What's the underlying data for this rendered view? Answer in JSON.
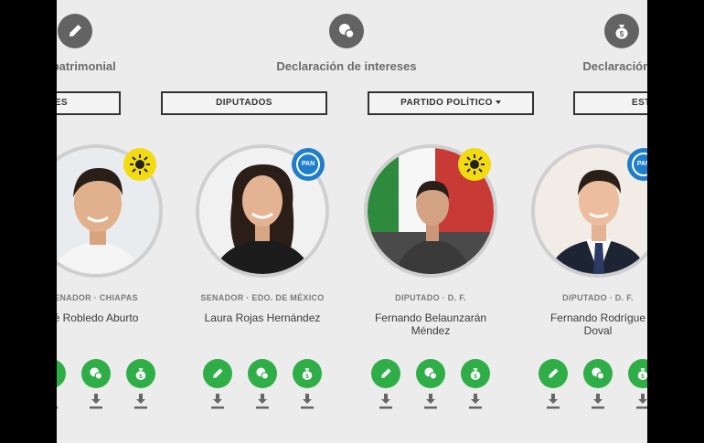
{
  "header": {
    "patrimonial": {
      "label": "ón patrimonial",
      "icon": "pen-icon"
    },
    "intereses": {
      "label": "Declaración de intereses",
      "icon": "chat-bubbles-icon"
    },
    "fiscal": {
      "label": "Declaración F",
      "icon": "money-bag-icon"
    }
  },
  "filters": {
    "partial_left": "ES",
    "diputados": "DIPUTADOS",
    "partido": "PARTIDO POLÍTICO",
    "partial_right": "EST"
  },
  "cards": [
    {
      "role": "ENADOR · CHIAPAS",
      "name_line1": "é Robledo Aburto",
      "name_line2": "",
      "party": "PRD",
      "badge_color": "#f3db12"
    },
    {
      "role": "SENADOR · EDO. DE MÉXICO",
      "name_line1": "Laura Rojas Hernández",
      "name_line2": "",
      "party": "PAN",
      "badge_color": "#1e7ecb"
    },
    {
      "role": "DIPUTADO · D. F.",
      "name_line1": "Fernando Belaunzarán",
      "name_line2": "Méndez",
      "party": "PRD",
      "badge_color": "#f3db12"
    },
    {
      "role": "DIPUTADO · D. F.",
      "name_line1": "Fernando Rodrígue",
      "name_line2": "Doval",
      "party": "PAN",
      "badge_color": "#1e7ecb"
    }
  ],
  "action_icons": [
    "pen-icon",
    "chat-bubbles-icon",
    "money-bag-icon",
    "download-icon"
  ],
  "colors": {
    "background": "#ececec",
    "action_green": "#2fae47",
    "header_icon_gray": "#636363",
    "frame": "#000000"
  }
}
